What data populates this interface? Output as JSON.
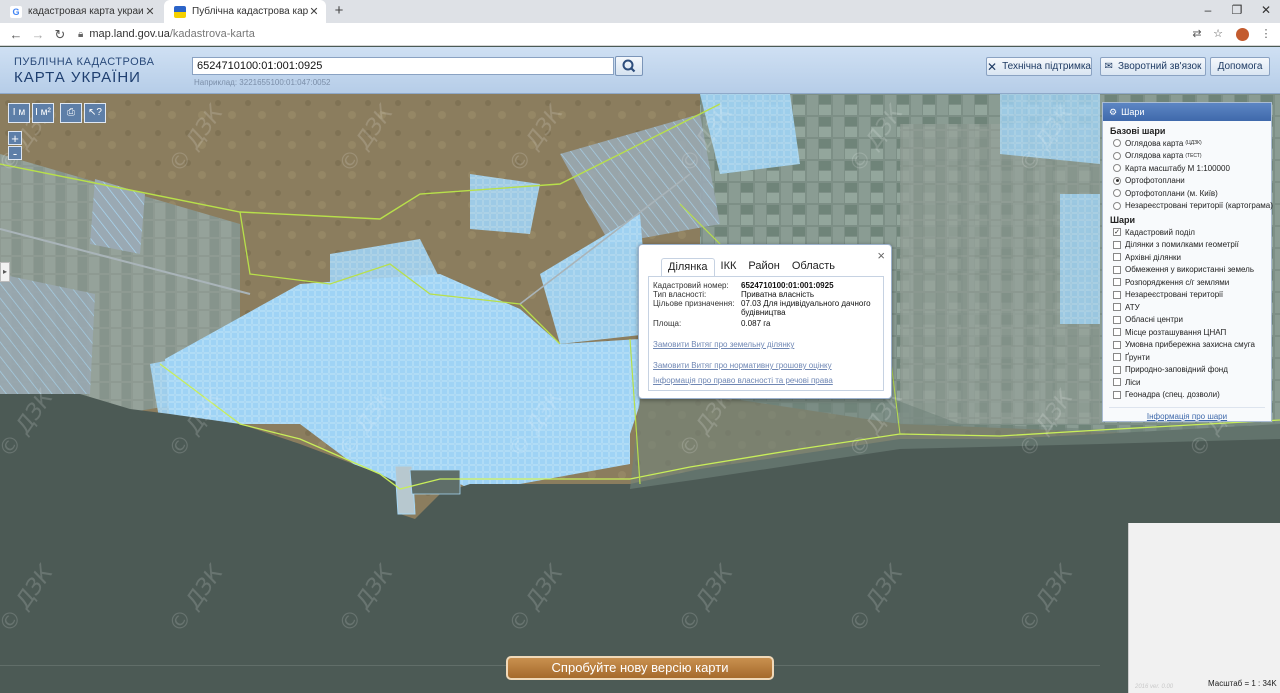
{
  "browser": {
    "tabs": [
      {
        "title": "кадастровая карта украин\\ - По",
        "active": false,
        "close": "✕"
      },
      {
        "title": "Публічна кадастрова карта Укр",
        "active": true,
        "close": "✕"
      }
    ],
    "new_tab": "+",
    "url_host": "map.land.gov.ua",
    "url_path": "/kadastrova-karta",
    "window_controls": [
      "⧉",
      "❐",
      "✕"
    ]
  },
  "header": {
    "logo_line1": "ПУБЛІЧНА КАДАСТРОВА",
    "logo_line2": "КАРТА УКРАЇНИ",
    "search_value": "6524710100:01:001:0925",
    "search_hint": "Наприклад: 3221655100:01:047:0052",
    "buttons": {
      "support": "Технічна підтримка",
      "feedback": "Зворотний зв'язок",
      "help": "Допомога"
    }
  },
  "map_tools": {
    "buttons": [
      "I м",
      "I м²",
      "⎙",
      "↖?"
    ],
    "zoom_in": "+",
    "zoom_out": "-"
  },
  "popup": {
    "tabs": [
      "Ділянка",
      "ІКК",
      "Район",
      "Область"
    ],
    "selected_tab": "Ділянка",
    "close": "×",
    "fields": {
      "cad_label": "Кадастровий номер:",
      "cad_value": "6524710100:01:001:0925",
      "ownership_label": "Тип власності:",
      "ownership_value": "Приватна власність",
      "purpose_label": "Цільове призначення:",
      "purpose_value": "07.03 Для індивідуального дачного будівництва",
      "area_label": "Площа:",
      "area_value": "0.087 га"
    },
    "links": {
      "extract_parcel": "Замовити Витяг про земельну ділянку",
      "extract_valuation": "Замовити Витяг про нормативну грошову оцінку",
      "rights_info": "Інформація про право власності та речові права"
    }
  },
  "layers": {
    "title": "Шари",
    "base_title": "Базові шари",
    "base": [
      {
        "label": "Оглядова карта",
        "sup": "(ЦДЗК)",
        "on": false
      },
      {
        "label": "Оглядова карта",
        "sup": "(ТЕСТ)",
        "on": false
      },
      {
        "label": "Карта масштабу М 1:100000",
        "sup": "",
        "on": false
      },
      {
        "label": "Ортофотоплани",
        "sup": "",
        "on": true
      },
      {
        "label": "Ортофотоплани (м. Київ)",
        "sup": "",
        "on": false
      },
      {
        "label": "Незареєстровані території (картограма)",
        "sup": "",
        "on": false
      }
    ],
    "overlay_title": "Шари",
    "overlays": [
      {
        "label": "Кадастровий поділ",
        "on": true
      },
      {
        "label": "Ділянки з помилками геометрії",
        "on": false
      },
      {
        "label": "Архівні ділянки",
        "on": false
      },
      {
        "label": "Обмеження у використанні земель",
        "on": false
      },
      {
        "label": "Розпорядження с/г землями",
        "on": false
      },
      {
        "label": "Незареєстровані території",
        "on": false
      },
      {
        "label": "АТУ",
        "on": false
      },
      {
        "label": "Обласні центри",
        "on": false
      },
      {
        "label": "Місце розташування ЦНАП",
        "on": false
      },
      {
        "label": "Умовна прибережна захисна смуга",
        "on": false
      },
      {
        "label": "Ґрунти",
        "on": false
      },
      {
        "label": "Природно-заповідний фонд",
        "on": false
      },
      {
        "label": "Ліси",
        "on": false
      },
      {
        "label": "Геонадра (спец. дозволи)",
        "on": false
      }
    ],
    "info_link": "Інформація про шари"
  },
  "watermark": "© ДЗК",
  "scale_label": "Масштаб = 1 : 34K",
  "copyright": "2016 ver. 0.00",
  "new_version_button": "Спробуйте нову версію карти",
  "colors": {
    "parcel_fill": "#8fc8f0",
    "parcel_stroke": "#b8e3ff",
    "boundary": "#b6e04a",
    "sea": "#4c5a55",
    "header_accent": "#3f69ab"
  }
}
